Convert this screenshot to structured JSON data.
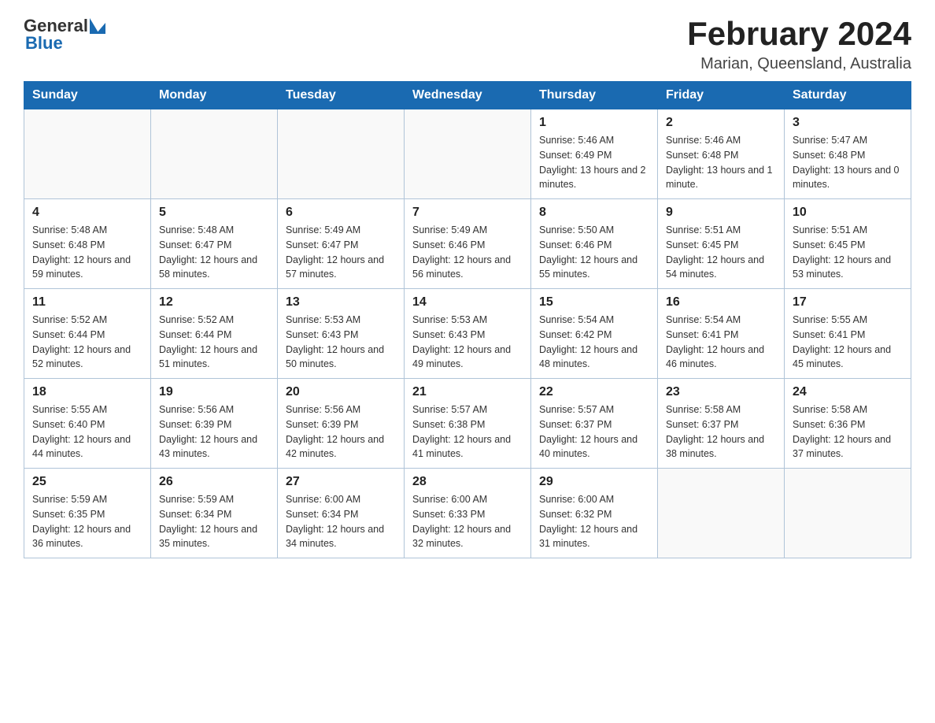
{
  "header": {
    "month_title": "February 2024",
    "location": "Marian, Queensland, Australia",
    "logo_general": "General",
    "logo_blue": "Blue"
  },
  "days_of_week": [
    "Sunday",
    "Monday",
    "Tuesday",
    "Wednesday",
    "Thursday",
    "Friday",
    "Saturday"
  ],
  "weeks": [
    [
      {
        "day": "",
        "sunrise": "",
        "sunset": "",
        "daylight": ""
      },
      {
        "day": "",
        "sunrise": "",
        "sunset": "",
        "daylight": ""
      },
      {
        "day": "",
        "sunrise": "",
        "sunset": "",
        "daylight": ""
      },
      {
        "day": "",
        "sunrise": "",
        "sunset": "",
        "daylight": ""
      },
      {
        "day": "1",
        "sunrise": "Sunrise: 5:46 AM",
        "sunset": "Sunset: 6:49 PM",
        "daylight": "Daylight: 13 hours and 2 minutes."
      },
      {
        "day": "2",
        "sunrise": "Sunrise: 5:46 AM",
        "sunset": "Sunset: 6:48 PM",
        "daylight": "Daylight: 13 hours and 1 minute."
      },
      {
        "day": "3",
        "sunrise": "Sunrise: 5:47 AM",
        "sunset": "Sunset: 6:48 PM",
        "daylight": "Daylight: 13 hours and 0 minutes."
      }
    ],
    [
      {
        "day": "4",
        "sunrise": "Sunrise: 5:48 AM",
        "sunset": "Sunset: 6:48 PM",
        "daylight": "Daylight: 12 hours and 59 minutes."
      },
      {
        "day": "5",
        "sunrise": "Sunrise: 5:48 AM",
        "sunset": "Sunset: 6:47 PM",
        "daylight": "Daylight: 12 hours and 58 minutes."
      },
      {
        "day": "6",
        "sunrise": "Sunrise: 5:49 AM",
        "sunset": "Sunset: 6:47 PM",
        "daylight": "Daylight: 12 hours and 57 minutes."
      },
      {
        "day": "7",
        "sunrise": "Sunrise: 5:49 AM",
        "sunset": "Sunset: 6:46 PM",
        "daylight": "Daylight: 12 hours and 56 minutes."
      },
      {
        "day": "8",
        "sunrise": "Sunrise: 5:50 AM",
        "sunset": "Sunset: 6:46 PM",
        "daylight": "Daylight: 12 hours and 55 minutes."
      },
      {
        "day": "9",
        "sunrise": "Sunrise: 5:51 AM",
        "sunset": "Sunset: 6:45 PM",
        "daylight": "Daylight: 12 hours and 54 minutes."
      },
      {
        "day": "10",
        "sunrise": "Sunrise: 5:51 AM",
        "sunset": "Sunset: 6:45 PM",
        "daylight": "Daylight: 12 hours and 53 minutes."
      }
    ],
    [
      {
        "day": "11",
        "sunrise": "Sunrise: 5:52 AM",
        "sunset": "Sunset: 6:44 PM",
        "daylight": "Daylight: 12 hours and 52 minutes."
      },
      {
        "day": "12",
        "sunrise": "Sunrise: 5:52 AM",
        "sunset": "Sunset: 6:44 PM",
        "daylight": "Daylight: 12 hours and 51 minutes."
      },
      {
        "day": "13",
        "sunrise": "Sunrise: 5:53 AM",
        "sunset": "Sunset: 6:43 PM",
        "daylight": "Daylight: 12 hours and 50 minutes."
      },
      {
        "day": "14",
        "sunrise": "Sunrise: 5:53 AM",
        "sunset": "Sunset: 6:43 PM",
        "daylight": "Daylight: 12 hours and 49 minutes."
      },
      {
        "day": "15",
        "sunrise": "Sunrise: 5:54 AM",
        "sunset": "Sunset: 6:42 PM",
        "daylight": "Daylight: 12 hours and 48 minutes."
      },
      {
        "day": "16",
        "sunrise": "Sunrise: 5:54 AM",
        "sunset": "Sunset: 6:41 PM",
        "daylight": "Daylight: 12 hours and 46 minutes."
      },
      {
        "day": "17",
        "sunrise": "Sunrise: 5:55 AM",
        "sunset": "Sunset: 6:41 PM",
        "daylight": "Daylight: 12 hours and 45 minutes."
      }
    ],
    [
      {
        "day": "18",
        "sunrise": "Sunrise: 5:55 AM",
        "sunset": "Sunset: 6:40 PM",
        "daylight": "Daylight: 12 hours and 44 minutes."
      },
      {
        "day": "19",
        "sunrise": "Sunrise: 5:56 AM",
        "sunset": "Sunset: 6:39 PM",
        "daylight": "Daylight: 12 hours and 43 minutes."
      },
      {
        "day": "20",
        "sunrise": "Sunrise: 5:56 AM",
        "sunset": "Sunset: 6:39 PM",
        "daylight": "Daylight: 12 hours and 42 minutes."
      },
      {
        "day": "21",
        "sunrise": "Sunrise: 5:57 AM",
        "sunset": "Sunset: 6:38 PM",
        "daylight": "Daylight: 12 hours and 41 minutes."
      },
      {
        "day": "22",
        "sunrise": "Sunrise: 5:57 AM",
        "sunset": "Sunset: 6:37 PM",
        "daylight": "Daylight: 12 hours and 40 minutes."
      },
      {
        "day": "23",
        "sunrise": "Sunrise: 5:58 AM",
        "sunset": "Sunset: 6:37 PM",
        "daylight": "Daylight: 12 hours and 38 minutes."
      },
      {
        "day": "24",
        "sunrise": "Sunrise: 5:58 AM",
        "sunset": "Sunset: 6:36 PM",
        "daylight": "Daylight: 12 hours and 37 minutes."
      }
    ],
    [
      {
        "day": "25",
        "sunrise": "Sunrise: 5:59 AM",
        "sunset": "Sunset: 6:35 PM",
        "daylight": "Daylight: 12 hours and 36 minutes."
      },
      {
        "day": "26",
        "sunrise": "Sunrise: 5:59 AM",
        "sunset": "Sunset: 6:34 PM",
        "daylight": "Daylight: 12 hours and 35 minutes."
      },
      {
        "day": "27",
        "sunrise": "Sunrise: 6:00 AM",
        "sunset": "Sunset: 6:34 PM",
        "daylight": "Daylight: 12 hours and 34 minutes."
      },
      {
        "day": "28",
        "sunrise": "Sunrise: 6:00 AM",
        "sunset": "Sunset: 6:33 PM",
        "daylight": "Daylight: 12 hours and 32 minutes."
      },
      {
        "day": "29",
        "sunrise": "Sunrise: 6:00 AM",
        "sunset": "Sunset: 6:32 PM",
        "daylight": "Daylight: 12 hours and 31 minutes."
      },
      {
        "day": "",
        "sunrise": "",
        "sunset": "",
        "daylight": ""
      },
      {
        "day": "",
        "sunrise": "",
        "sunset": "",
        "daylight": ""
      }
    ]
  ]
}
